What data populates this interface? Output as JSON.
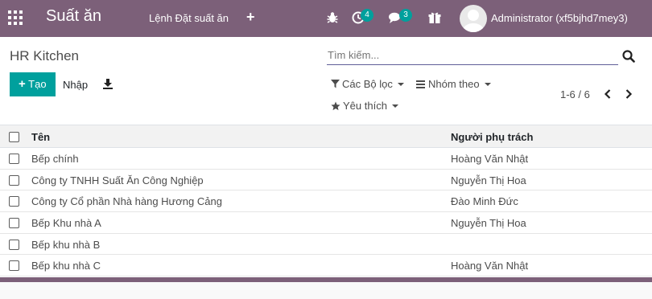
{
  "navbar": {
    "brand": "Suất ăn",
    "menu_order": "Lệnh Đặt suất ăn",
    "activity_badge": "4",
    "messages_badge": "3",
    "user": "Administrator (xf5bjhd7mey3)",
    "colors": {
      "bg": "#7c6079",
      "badge": "#00a09d"
    }
  },
  "control": {
    "breadcrumb": "HR Kitchen",
    "search_placeholder": "Tìm kiếm...",
    "create_label": "Tạo",
    "import_label": "Nhập",
    "filters_label": "Các Bộ lọc",
    "groupby_label": "Nhóm theo",
    "favorites_label": "Yêu thích",
    "pager": "1-6 / 6"
  },
  "list": {
    "columns": [
      "Tên",
      "Người phụ trách"
    ],
    "rows": [
      {
        "name": "Bếp chính",
        "responsible": "Hoàng Văn Nhật"
      },
      {
        "name": "Công ty TNHH Suất Ăn Công Nghiệp",
        "responsible": "Nguyễn Thị Hoa"
      },
      {
        "name": "Công ty Cổ phần Nhà hàng Hương Cảng",
        "responsible": "Đào Minh Đức"
      },
      {
        "name": "Bếp Khu nhà A",
        "responsible": "Nguyễn Thị Hoa"
      },
      {
        "name": "Bếp khu nhà B",
        "responsible": ""
      },
      {
        "name": "Bếp khu nhà C",
        "responsible": "Hoàng Văn Nhật"
      }
    ]
  }
}
